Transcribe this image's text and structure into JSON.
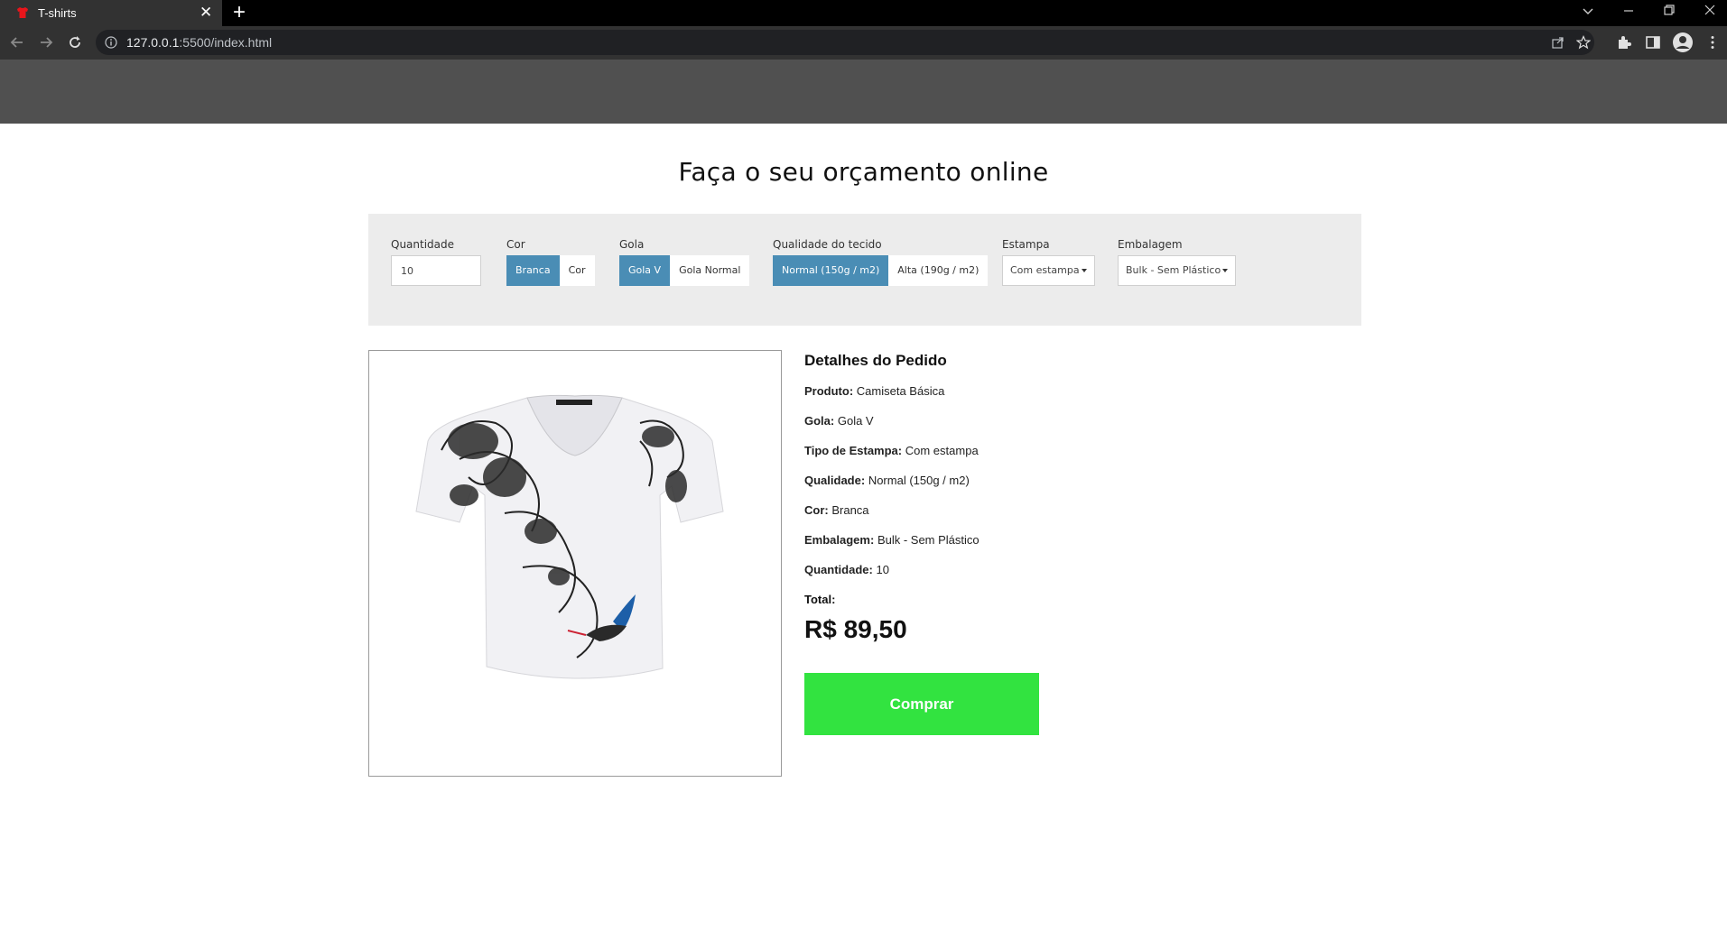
{
  "browser": {
    "tab_title": "T-shirts",
    "url_host": "127.0.0.1",
    "url_rest": ":5500/index.html"
  },
  "page": {
    "title": "Faça o seu orçamento online"
  },
  "options": {
    "quantity": {
      "label": "Quantidade",
      "value": "10"
    },
    "color": {
      "label": "Cor",
      "options": [
        "Branca",
        "Cor"
      ],
      "selected": "Branca"
    },
    "collar": {
      "label": "Gola",
      "options": [
        "Gola V",
        "Gola Normal"
      ],
      "selected": "Gola V"
    },
    "quality": {
      "label": "Qualidade do tecido",
      "options": [
        "Normal (150g / m2)",
        "Alta (190g / m2)"
      ],
      "selected": "Normal (150g / m2)"
    },
    "print": {
      "label": "Estampa",
      "value": "Com estampa"
    },
    "packaging": {
      "label": "Embalagem",
      "value": "Bulk - Sem Plástico"
    }
  },
  "details": {
    "title": "Detalhes do Pedido",
    "rows": [
      {
        "key": "Produto:",
        "value": "Camiseta Básica"
      },
      {
        "key": "Gola:",
        "value": "Gola V"
      },
      {
        "key": "Tipo de Estampa:",
        "value": "Com estampa"
      },
      {
        "key": "Qualidade:",
        "value": "Normal (150g / m2)"
      },
      {
        "key": "Cor:",
        "value": "Branca"
      },
      {
        "key": "Embalagem:",
        "value": "Bulk - Sem Plástico"
      },
      {
        "key": "Quantidade:",
        "value": "10"
      }
    ],
    "total_label": "Total:",
    "price": "R$ 89,50",
    "buy_label": "Comprar"
  },
  "colors": {
    "header": "#505050",
    "panel": "#ececec",
    "active": "#4a8db5",
    "buy": "#32e340"
  }
}
